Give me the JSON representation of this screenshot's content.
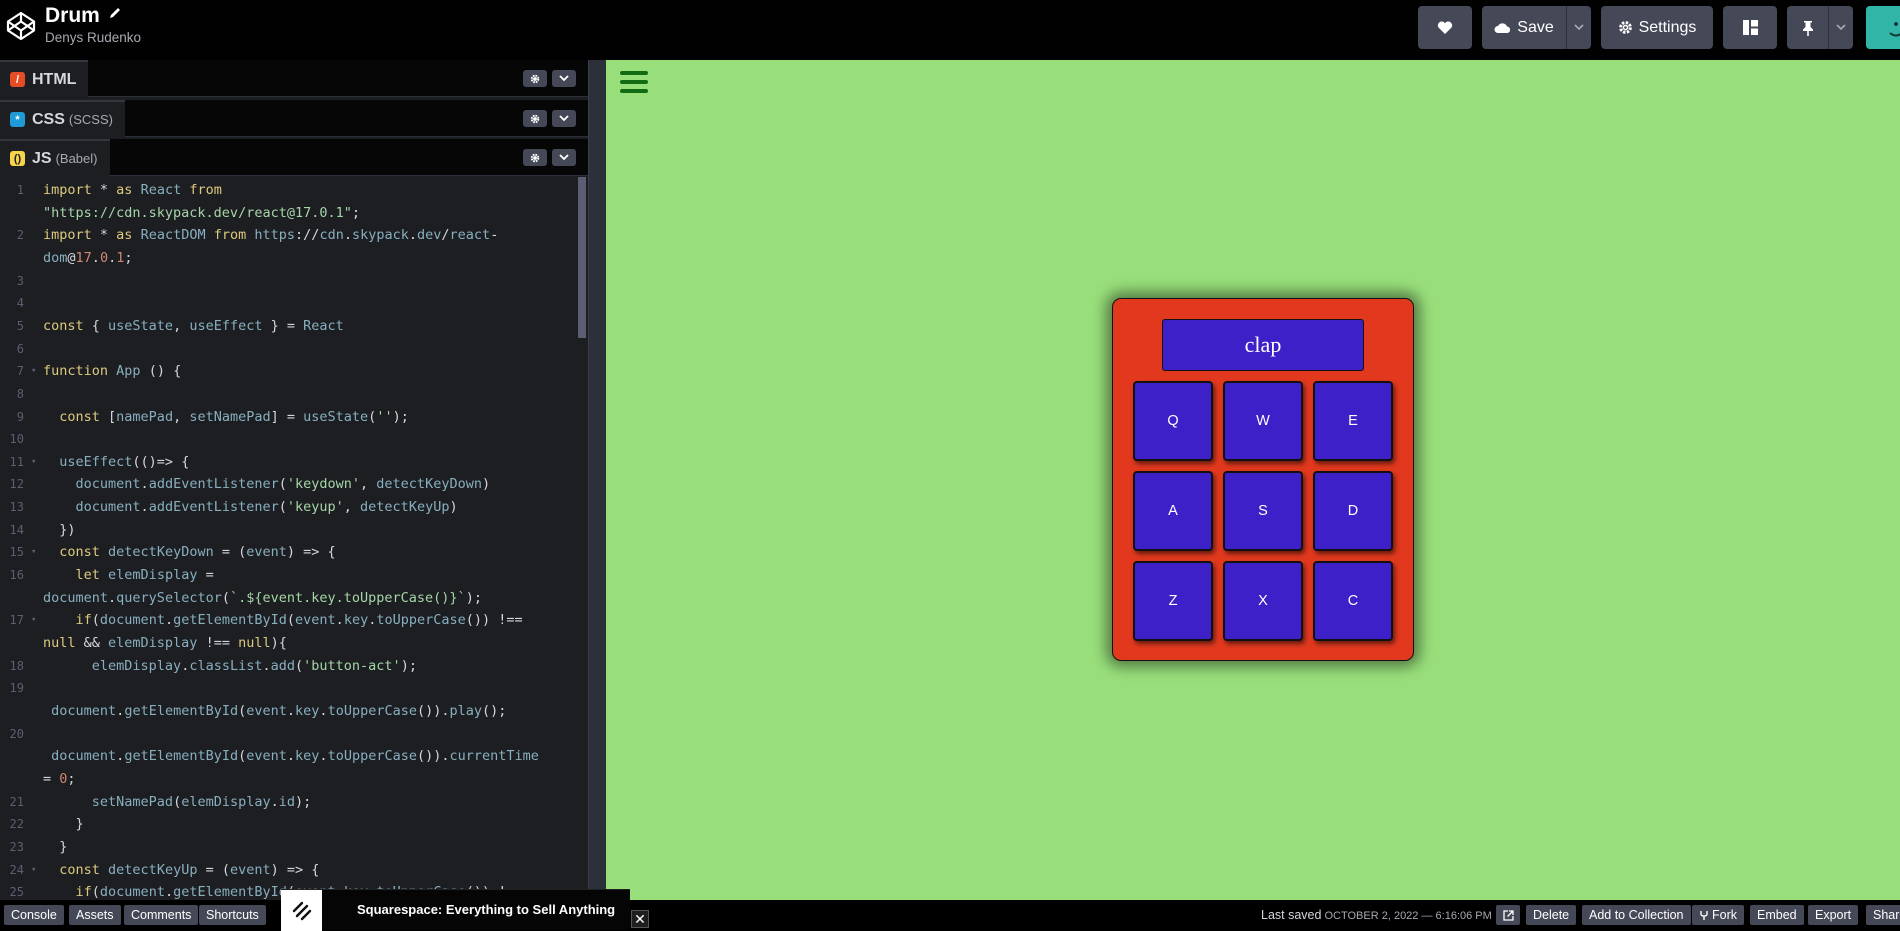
{
  "header": {
    "title": "Drum",
    "author": "Denys Rudenko",
    "save_label": "Save",
    "settings_label": "Settings"
  },
  "panels": [
    {
      "name": "HTML",
      "sub": "",
      "badge_color": "#e44d26"
    },
    {
      "name": "CSS",
      "sub": "(SCSS)",
      "badge_color": "#1e9bd7"
    },
    {
      "name": "JS",
      "sub": "(Babel)",
      "badge_color": "#f7d44a"
    }
  ],
  "code_lines": [
    {
      "n": "1",
      "t": "import * as React from"
    },
    {
      "n": "",
      "t": "\"https://cdn.skypack.dev/react@17.0.1\";"
    },
    {
      "n": "2",
      "t": "import * as ReactDOM from \"https://cdn.skypack.dev/react-"
    },
    {
      "n": "",
      "t": "dom@17.0.1\";"
    },
    {
      "n": "3",
      "t": ""
    },
    {
      "n": "4",
      "t": ""
    },
    {
      "n": "5",
      "t": "const { useState, useEffect } = React"
    },
    {
      "n": "6",
      "t": ""
    },
    {
      "n": "7",
      "t": "function App () {"
    },
    {
      "n": "8",
      "t": ""
    },
    {
      "n": "9",
      "t": "  const [namePad, setNamePad] = useState('');"
    },
    {
      "n": "10",
      "t": ""
    },
    {
      "n": "11",
      "t": "  useEffect(()=> {"
    },
    {
      "n": "12",
      "t": "    document.addEventListener('keydown', detectKeyDown)"
    },
    {
      "n": "13",
      "t": "    document.addEventListener('keyup', detectKeyUp)"
    },
    {
      "n": "14",
      "t": "  })"
    },
    {
      "n": "15",
      "t": "  const detectKeyDown = (event) => {"
    },
    {
      "n": "16",
      "t": "    let elemDisplay ="
    },
    {
      "n": "",
      "t": "document.querySelector(`.${event.key.toUpperCase()}`);"
    },
    {
      "n": "17",
      "t": "    if(document.getElementById(event.key.toUpperCase()) !=="
    },
    {
      "n": "",
      "t": "null && elemDisplay !== null){"
    },
    {
      "n": "18",
      "t": "      elemDisplay.classList.add('button-act');"
    },
    {
      "n": "19",
      "t": ""
    },
    {
      "n": "",
      "t": " document.getElementById(event.key.toUpperCase()).play();"
    },
    {
      "n": "20",
      "t": ""
    },
    {
      "n": "",
      "t": " document.getElementById(event.key.toUpperCase()).currentTime"
    },
    {
      "n": "",
      "t": "= 0;"
    },
    {
      "n": "21",
      "t": "      setNamePad(elemDisplay.id);"
    },
    {
      "n": "22",
      "t": "    }"
    },
    {
      "n": "23",
      "t": "  }"
    },
    {
      "n": "24",
      "t": "  const detectKeyUp = (event) => {"
    },
    {
      "n": "25",
      "t": "    if(document.getElementById(event.key.toUpperCase()) !=="
    }
  ],
  "drum": {
    "display": "clap",
    "pads": [
      "Q",
      "W",
      "E",
      "A",
      "S",
      "D",
      "Z",
      "X",
      "C"
    ]
  },
  "footer": {
    "console": "Console",
    "assets": "Assets",
    "comments": "Comments",
    "shortcuts": "Shortcuts",
    "ad_text": "Squarespace: Everything to Sell Anything",
    "ad_close": "✕",
    "last_saved_label": "Last saved",
    "last_saved_date": "OCTOBER 2, 2022 — 6:16:06 PM",
    "delete": "Delete",
    "add_to_collection": "Add to Collection",
    "fork": "Fork",
    "embed": "Embed",
    "export": "Export",
    "share": "Share"
  },
  "colors": {
    "preview_bg": "#98df7b",
    "machine_bg": "#e2391e",
    "pad_bg": "#3e20c8",
    "editor_bg": "#1d1e22",
    "button_bg": "#444857"
  }
}
